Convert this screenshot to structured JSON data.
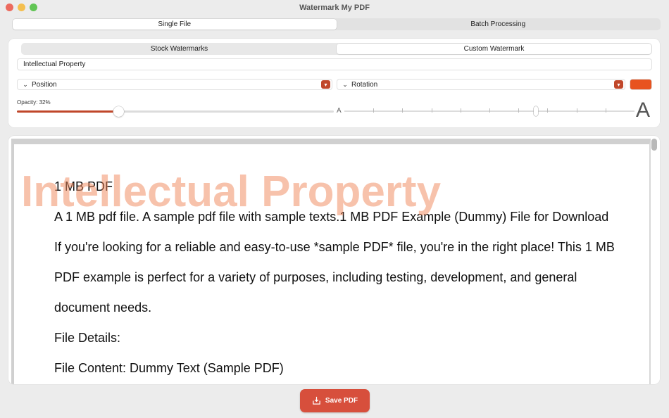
{
  "window": {
    "title": "Watermark My PDF"
  },
  "mode_tabs": [
    {
      "label": "Single File",
      "active": true
    },
    {
      "label": "Batch Processing",
      "active": false
    }
  ],
  "watermark_tabs": [
    {
      "label": "Stock Watermarks",
      "active": false
    },
    {
      "label": "Custom Watermark",
      "active": true
    }
  ],
  "watermark_text": "Intellectual Property",
  "position_dropdown": {
    "label": "Position",
    "icon": "chevron-down-icon"
  },
  "rotation_dropdown": {
    "label": "Rotation",
    "icon": "chevron-down-icon"
  },
  "color": "#e8531f",
  "accent": "#c0472a",
  "opacity": {
    "label": "Opacity: 32%",
    "value": 0.32
  },
  "size_slider": {
    "small_label": "A",
    "large_label": "A",
    "value": 0.66,
    "ticks": 10
  },
  "preview": {
    "watermark": "Intellectual Property",
    "lines": [
      "1 MB PDF",
      "A 1 MB pdf file. A sample pdf file with sample texts.1 MB PDF Example (Dummy) File for Download",
      "If you're looking for a reliable and easy-to-use *sample PDF* file, you're in the right place! This 1 MB",
      "PDF example is perfect for a variety of purposes, including testing, development, and general",
      "document needs.",
      "File Details:",
      "File Content: Dummy Text (Sample PDF)"
    ]
  },
  "save_button": {
    "label": "Save PDF",
    "icon": "save-download-icon"
  }
}
